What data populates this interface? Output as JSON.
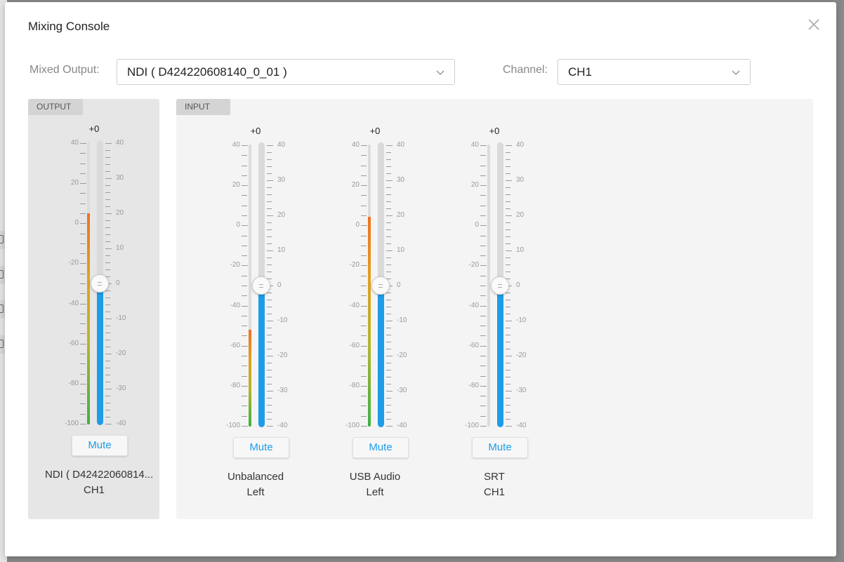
{
  "dialog": {
    "title": "Mixing Console"
  },
  "mixed_output": {
    "label": "Mixed Output:",
    "value": "NDI ( D424220608140_0_01 )"
  },
  "channel": {
    "label": "Channel:",
    "value": "CH1"
  },
  "output_panel": {
    "tag": "OUTPUT",
    "strip": {
      "db": "+0",
      "mute_label": "Mute",
      "name_line1": "NDI ( D42422060814...",
      "name_line2": "CH1",
      "meter_level_db": 5,
      "fader_db": 0
    }
  },
  "input_panel": {
    "tag": "INPUT",
    "strips": [
      {
        "db": "+0",
        "mute_label": "Mute",
        "name_line1": "Unbalanced",
        "name_line2": "Left",
        "meter_level_db": -52,
        "fader_db": 0
      },
      {
        "db": "+0",
        "mute_label": "Mute",
        "name_line1": "USB Audio",
        "name_line2": "Left",
        "meter_level_db": 4,
        "fader_db": 0
      },
      {
        "db": "+0",
        "mute_label": "Mute",
        "name_line1": "SRT",
        "name_line2": "CH1",
        "meter_level_db": -100,
        "fader_db": 0
      }
    ]
  },
  "meter_scale": [
    "40",
    "20",
    "0",
    "-20",
    "-40",
    "-60",
    "-80",
    "-100"
  ],
  "fader_scale": [
    "40",
    "30",
    "20",
    "10",
    "0",
    "-10",
    "-20",
    "-30",
    "-40"
  ],
  "colors": {
    "accent": "#1e9ce8",
    "meter_low": "#3cb043",
    "meter_high": "#f07020"
  },
  "icons": {
    "close": "close-icon",
    "dropdown": "chevron-down-icon"
  }
}
